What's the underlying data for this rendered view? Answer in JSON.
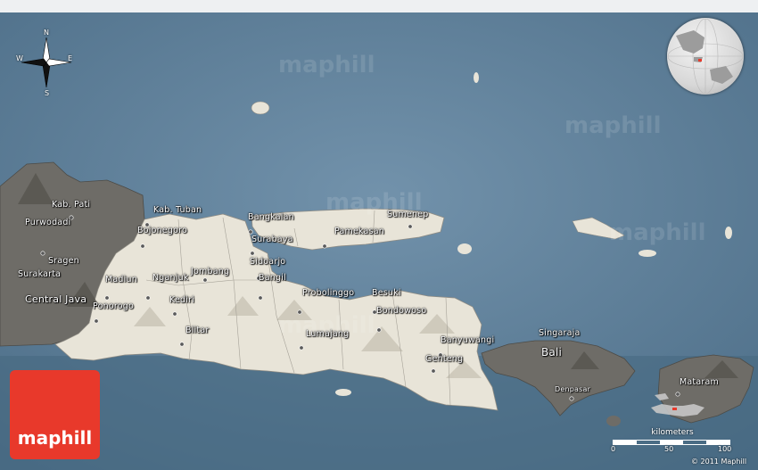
{
  "watermarks": [
    "maphill",
    "maphill",
    "maphill",
    "maphill",
    "maphill"
  ],
  "compass": {
    "n": "N",
    "s": "S",
    "e": "E",
    "w": "W"
  },
  "places": {
    "kab_pati": "Kab. Pati",
    "purwodadi": "Purwodadi",
    "sragen": "Sragen",
    "surakarta": "Surakarta",
    "central_java": "Central Java",
    "kab_tuban": "Kab. Tuban",
    "bojonegoro": "Bojonegoro",
    "madiun": "Madiun",
    "nganjuk": "Nganjuk",
    "jombang": "Jombang",
    "ponorogo": "Ponorogo",
    "kediri": "Kediri",
    "blitar": "Blitar",
    "bangkalan": "Bangkalan",
    "surabaya": "Surabaya",
    "sidoarjo": "Sidoarjo",
    "bangil": "Bangil",
    "pamekasan": "Pamekasan",
    "sumenep": "Sumenep",
    "probolinggo": "Probolinggo",
    "besuki": "Besuki",
    "bondowoso": "Bondowoso",
    "lumajang": "Lumajang",
    "banyuwangi": "Banyuwangi",
    "genteng": "Genteng",
    "singaraja": "Singaraja",
    "bali": "Bali",
    "denpasar": "Denpasar",
    "mataram": "Mataram"
  },
  "scale": {
    "title": "kilometers",
    "ticks": [
      "0",
      "50",
      "100"
    ]
  },
  "logo": "maphill",
  "copyright": "© 2011 Maphill",
  "colors": {
    "sea": "#5e7f99",
    "highlight_land": "#e9e5da",
    "other_land": "#706e69",
    "logo": "#e8392b"
  }
}
